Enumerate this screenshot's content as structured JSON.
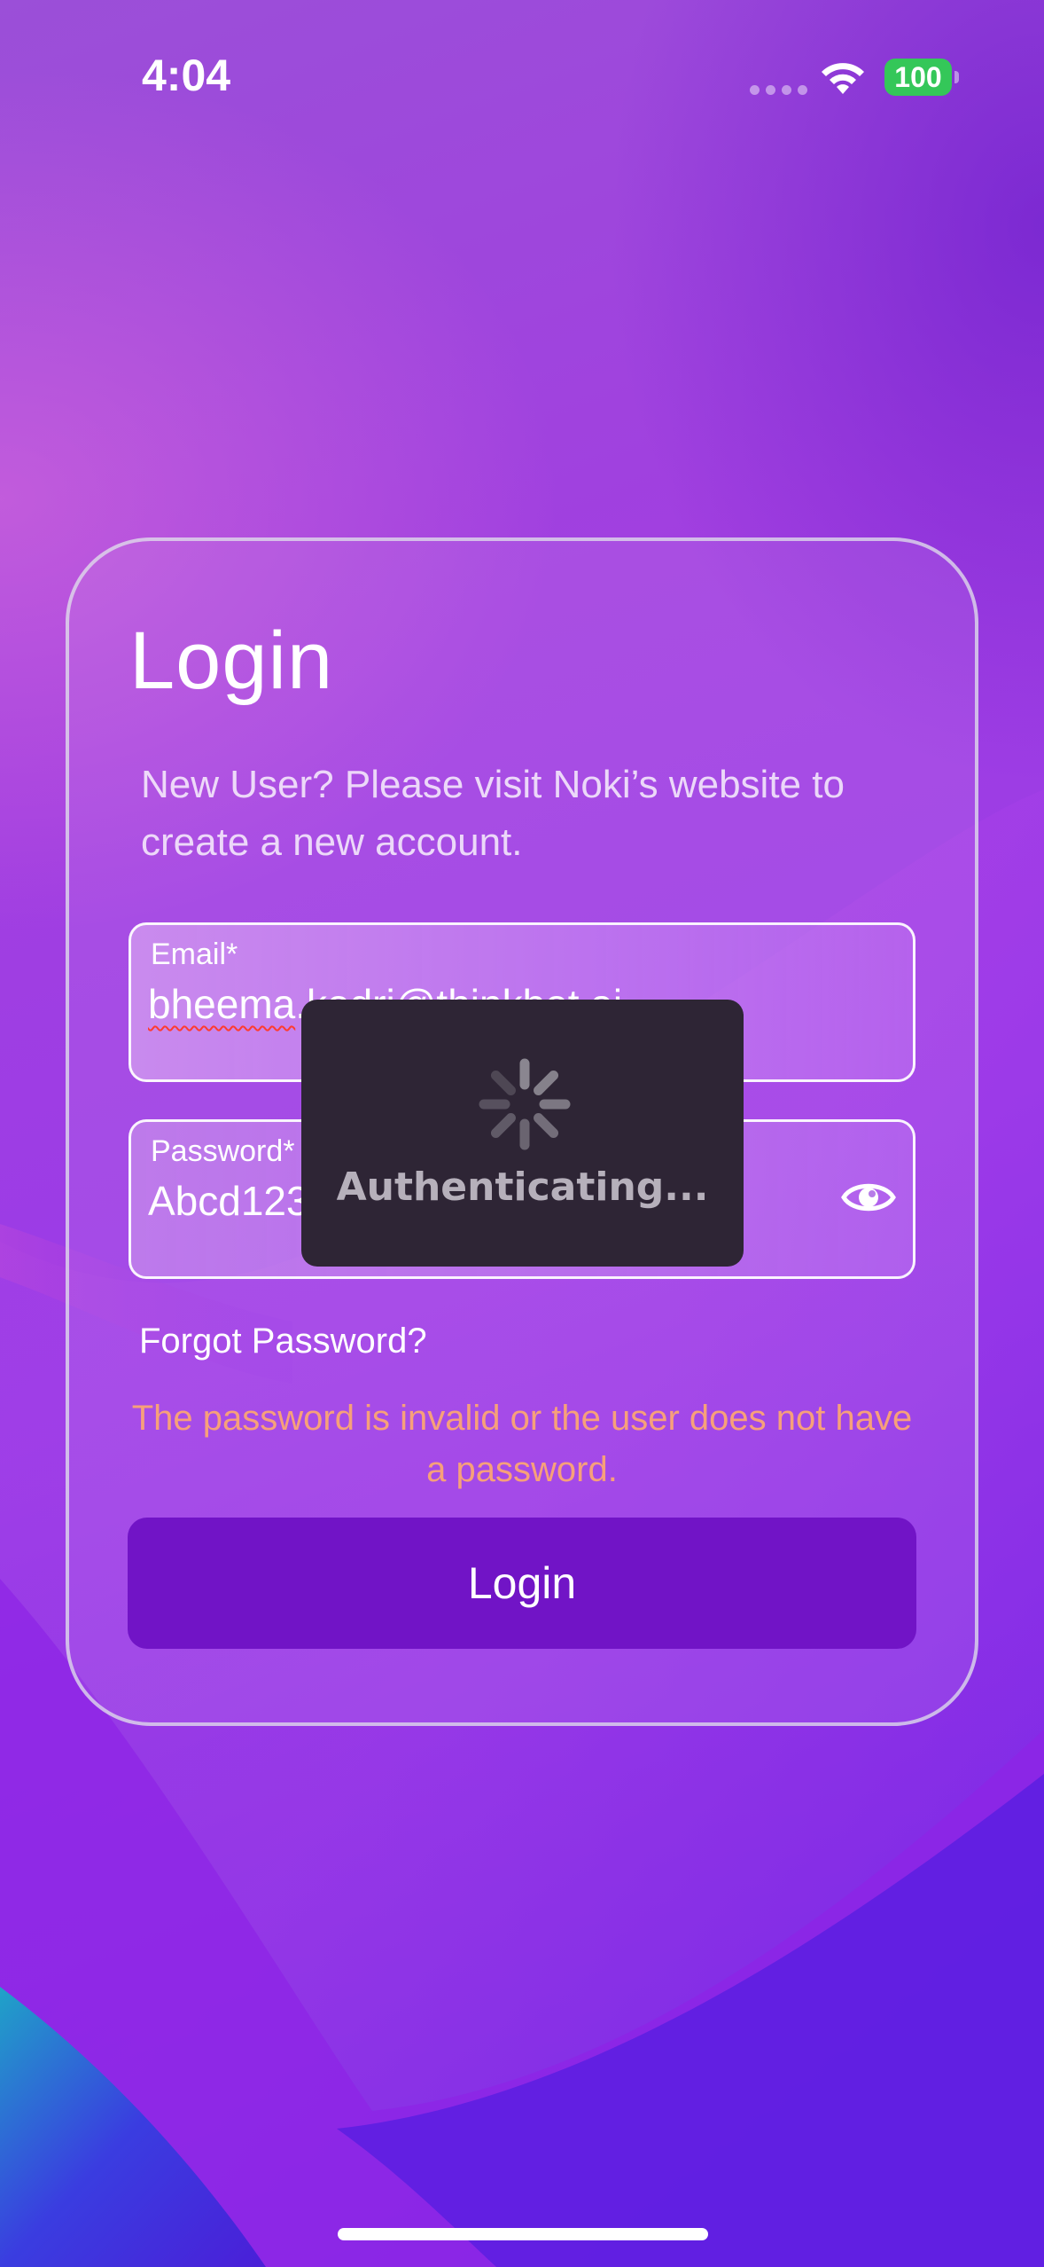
{
  "status_bar": {
    "time": "4:04",
    "battery_level": "100",
    "battery_color": "#34c759",
    "wifi_icon": "wifi-icon"
  },
  "login": {
    "title": "Login",
    "subtitle": "New User? Please visit Noki’s website to create a new account.",
    "email": {
      "label": "Email*",
      "value_misspelled_part": "bheema",
      "value_rest": ".kodri@thinkbot.ai"
    },
    "password": {
      "label": "Password*",
      "value": "Abcd123",
      "visibility_icon": "eye-icon"
    },
    "forgot_password": "Forgot Password?",
    "error_message": "The password is invalid or the user does not have a password.",
    "error_color": "#f7a07a",
    "submit_label": "Login",
    "button_color": "#7114c6"
  },
  "loading": {
    "label": "Authenticating...",
    "spinner_icon": "spinner-icon"
  }
}
